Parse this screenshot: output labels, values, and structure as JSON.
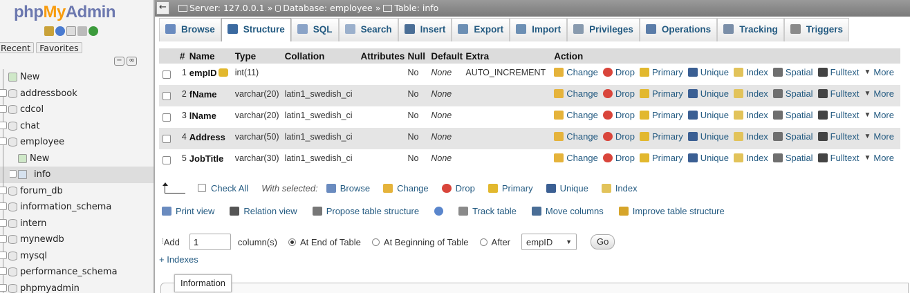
{
  "app": {
    "logo_php": "php",
    "logo_my": "My",
    "logo_admin": "Admin"
  },
  "nav": {
    "tabs": [
      "Recent",
      "Favorites"
    ],
    "tree": [
      {
        "label": "New",
        "type": "new"
      },
      {
        "label": "addressbook",
        "type": "db"
      },
      {
        "label": "cdcol",
        "type": "db"
      },
      {
        "label": "chat",
        "type": "db"
      },
      {
        "label": "employee",
        "type": "db-open"
      },
      {
        "label": "New",
        "type": "sub-new"
      },
      {
        "label": "info",
        "type": "sub-table",
        "selected": true
      },
      {
        "label": "forum_db",
        "type": "db"
      },
      {
        "label": "information_schema",
        "type": "db"
      },
      {
        "label": "intern",
        "type": "db"
      },
      {
        "label": "mynewdb",
        "type": "db"
      },
      {
        "label": "mysql",
        "type": "db"
      },
      {
        "label": "performance_schema",
        "type": "db"
      },
      {
        "label": "phpmyadmin",
        "type": "db"
      }
    ]
  },
  "breadcrumb": {
    "server": "Server: 127.0.0.1",
    "sep1": "»",
    "database": "Database: employee",
    "sep2": "»",
    "table": "Table: info"
  },
  "topmenu": [
    {
      "label": "Browse",
      "icon": "browse-icon",
      "color": "#6a8bbf"
    },
    {
      "label": "Structure",
      "icon": "structure-icon",
      "color": "#3b6aa0",
      "active": true
    },
    {
      "label": "SQL",
      "icon": "sql-icon",
      "color": "#8aa3c7"
    },
    {
      "label": "Search",
      "icon": "search-icon",
      "color": "#9bb0cc"
    },
    {
      "label": "Insert",
      "icon": "insert-icon",
      "color": "#4a6e96"
    },
    {
      "label": "Export",
      "icon": "export-icon",
      "color": "#6c8fb4"
    },
    {
      "label": "Import",
      "icon": "import-icon",
      "color": "#6c8fb4"
    },
    {
      "label": "Privileges",
      "icon": "privileges-icon",
      "color": "#889aae"
    },
    {
      "label": "Operations",
      "icon": "operations-icon",
      "color": "#5a7ca8"
    },
    {
      "label": "Tracking",
      "icon": "tracking-icon",
      "color": "#7a8ea8"
    },
    {
      "label": "Triggers",
      "icon": "triggers-icon",
      "color": "#8a8a8a"
    }
  ],
  "columns": {
    "num": "#",
    "name": "Name",
    "type": "Type",
    "collation": "Collation",
    "attributes": "Attributes",
    "null": "Null",
    "default": "Default",
    "extra": "Extra",
    "action": "Action"
  },
  "rows": [
    {
      "num": "1",
      "name": "empID",
      "primary": true,
      "type": "int(11)",
      "collation": "",
      "attributes": "",
      "null": "No",
      "default": "None",
      "extra": "AUTO_INCREMENT"
    },
    {
      "num": "2",
      "name": "fName",
      "primary": false,
      "type": "varchar(20)",
      "collation": "latin1_swedish_ci",
      "attributes": "",
      "null": "No",
      "default": "None",
      "extra": ""
    },
    {
      "num": "3",
      "name": "lName",
      "primary": false,
      "type": "varchar(20)",
      "collation": "latin1_swedish_ci",
      "attributes": "",
      "null": "No",
      "default": "None",
      "extra": ""
    },
    {
      "num": "4",
      "name": "Address",
      "primary": false,
      "type": "varchar(50)",
      "collation": "latin1_swedish_ci",
      "attributes": "",
      "null": "No",
      "default": "None",
      "extra": ""
    },
    {
      "num": "5",
      "name": "JobTitle",
      "primary": false,
      "type": "varchar(30)",
      "collation": "latin1_swedish_ci",
      "attributes": "",
      "null": "No",
      "default": "None",
      "extra": ""
    }
  ],
  "row_actions": [
    "Change",
    "Drop",
    "Primary",
    "Unique",
    "Index",
    "Spatial",
    "Fulltext",
    "More"
  ],
  "withselected": {
    "check_all": "Check All",
    "label": "With selected:",
    "actions": [
      "Browse",
      "Change",
      "Drop",
      "Primary",
      "Unique",
      "Index"
    ]
  },
  "tools": [
    "Print view",
    "Relation view",
    "Propose table structure",
    "Track table",
    "Move columns",
    "Improve table structure"
  ],
  "add": {
    "label": "Add",
    "value": "1",
    "unit": "column(s)",
    "opt_end": "At End of Table",
    "opt_begin": "At Beginning of Table",
    "opt_after": "After",
    "after_value": "empID",
    "go": "Go"
  },
  "indexes_link": "+ Indexes",
  "info_tab": "Information"
}
